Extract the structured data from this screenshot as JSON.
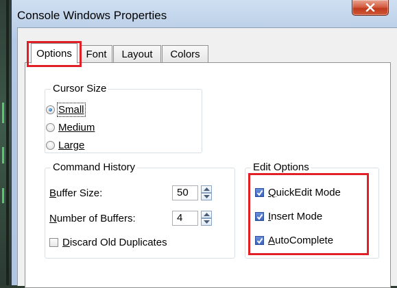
{
  "window": {
    "title": "Console Windows Properties",
    "close_glyph": "X"
  },
  "tabs": [
    {
      "label": "Options",
      "active": true
    },
    {
      "label": "Font",
      "active": false
    },
    {
      "label": "Layout",
      "active": false
    },
    {
      "label": "Colors",
      "active": false
    }
  ],
  "cursor_size": {
    "title": "Cursor Size",
    "options": [
      {
        "label": "Small",
        "selected": true
      },
      {
        "label": "Medium",
        "selected": false
      },
      {
        "label": "Large",
        "selected": false
      }
    ]
  },
  "command_history": {
    "title": "Command History",
    "buffer_size": {
      "label": "Buffer Size:",
      "value": "50"
    },
    "number_of_buffers": {
      "label": "Number of Buffers:",
      "value": "4"
    },
    "discard_duplicates": {
      "label": "Discard Old Duplicates",
      "checked": false
    }
  },
  "edit_options": {
    "title": "Edit Options",
    "items": [
      {
        "label": "QuickEdit Mode",
        "checked": true
      },
      {
        "label": "Insert Mode",
        "checked": true
      },
      {
        "label": "AutoComplete",
        "checked": true
      }
    ]
  },
  "colors": {
    "highlight": "#e01f26",
    "check_fill": "#3d65c1",
    "close_button": "#c94a2b"
  }
}
